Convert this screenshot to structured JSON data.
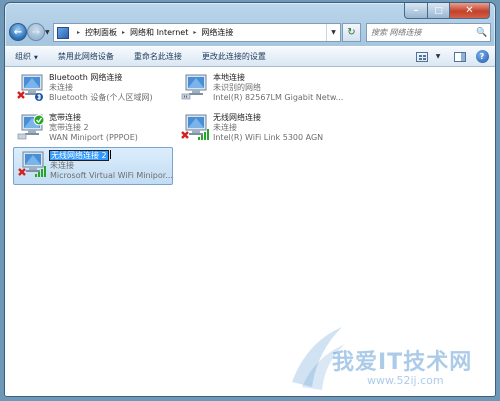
{
  "window": {
    "caption": {
      "minimize": "–",
      "maximize": "□",
      "close": "✕"
    }
  },
  "nav": {
    "back_icon": "←",
    "forward_icon": "→",
    "dropdown_icon": "▼",
    "breadcrumbs": [
      "控制面板",
      "网络和 Internet",
      "网络连接"
    ],
    "separator": "▸",
    "refresh_icon": "↻",
    "search_placeholder": "搜索 网络连接",
    "search_icon": "🔍"
  },
  "toolbar": {
    "organize_label": "组织",
    "organize_arrow": "▼",
    "disable_label": "禁用此网络设备",
    "rename_label": "重命名此连接",
    "change_settings_label": "更改此连接的设置",
    "views_arrow": "▼",
    "help_label": "?"
  },
  "connections": [
    {
      "name": "Bluetooth 网络连接",
      "status": "未连接",
      "device": "Bluetooth 设备(个人区域网)",
      "badge": "bluetooth-disconnected",
      "selected": false
    },
    {
      "name": "本地连接",
      "status": "未识别的网络",
      "device": "Intel(R) 82567LM Gigabit Netw...",
      "badge": "none",
      "selected": false
    },
    {
      "name": "宽带连接",
      "status": "宽带连接 2",
      "device": "WAN Miniport (PPPOE)",
      "badge": "dialup-ok",
      "selected": false
    },
    {
      "name": "无线网络连接",
      "status": "未连接",
      "device": "Intel(R) WiFi Link 5300 AGN",
      "badge": "wifi-disconnected",
      "selected": false
    },
    {
      "name": "无线网络连接 2",
      "status": "未连接",
      "device": "Microsoft Virtual WiFi Minipor...",
      "badge": "wifi-disconnected",
      "selected": true,
      "editing": true
    }
  ],
  "watermark": {
    "text": "我爱IT技术网",
    "url": "www.52ij.com"
  },
  "colors": {
    "selection_bg": "#c2dcf3",
    "edit_highlight": "#3399ff",
    "disconnected_red": "#d42020",
    "signal_green": "#2aa52a"
  }
}
